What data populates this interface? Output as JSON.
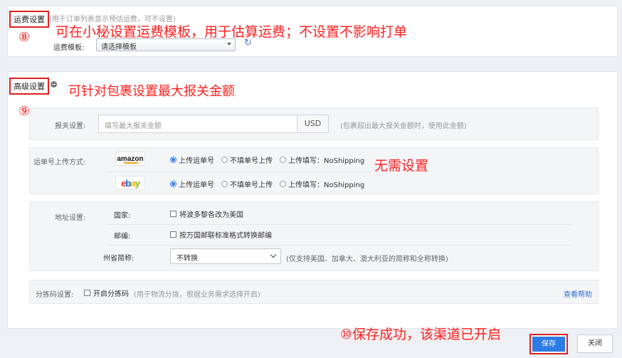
{
  "freight": {
    "title": "运费设置",
    "note": "(用于订单列表显示预估运费，可不设置)",
    "template_label": "运费模板:",
    "template_value": "请选择模板"
  },
  "advanced": {
    "title": "高级设置",
    "customs": {
      "label": "报关设置:",
      "placeholder": "填写最大报关金额",
      "unit": "USD",
      "note": "(包裹超出最大报关金额时，使用此金额)"
    },
    "tracking": {
      "label": "运单号上传方式:",
      "platforms": [
        {
          "name": "amazon",
          "options": [
            "上传运单号",
            "不填单号上传",
            "上传填写：NoShipping"
          ],
          "selected": 0
        },
        {
          "name": "ebay",
          "options": [
            "上传运单号",
            "不填单号上传",
            "上传填写：NoShipping"
          ],
          "selected": 0
        }
      ]
    },
    "address": {
      "label": "地址设置:",
      "country_label": "国家:",
      "country_check": "将波多黎各改为美国",
      "zip_label": "邮编:",
      "zip_check": "按万国邮联标准格式转换邮编",
      "state_label": "州省简称:",
      "state_value": "不转换",
      "state_note": "(仅支持美国、加拿大、澳大利亚的简称和全称转换)"
    },
    "sorting": {
      "label": "分拣码设置:",
      "check": "开启分拣码",
      "note": "(用于物流分拨，根据业务需求选择开启)",
      "help": "查看帮助"
    }
  },
  "annotations": {
    "a8_num": "⑧",
    "a8_text": "可在小秘设置运费模板，用于估算运费；不设置不影响打单",
    "a9_text": "可针对包裹设置最大报关金额",
    "a9_num": "⑨",
    "no_setting": "无需设置",
    "a10_text": "⑩保存成功，该渠道已开启"
  },
  "buttons": {
    "save": "保存",
    "close": "关闭"
  },
  "colors": {
    "accent": "#2d7be5",
    "annotation": "#ff1f1f",
    "link": "#2d6fd1"
  }
}
